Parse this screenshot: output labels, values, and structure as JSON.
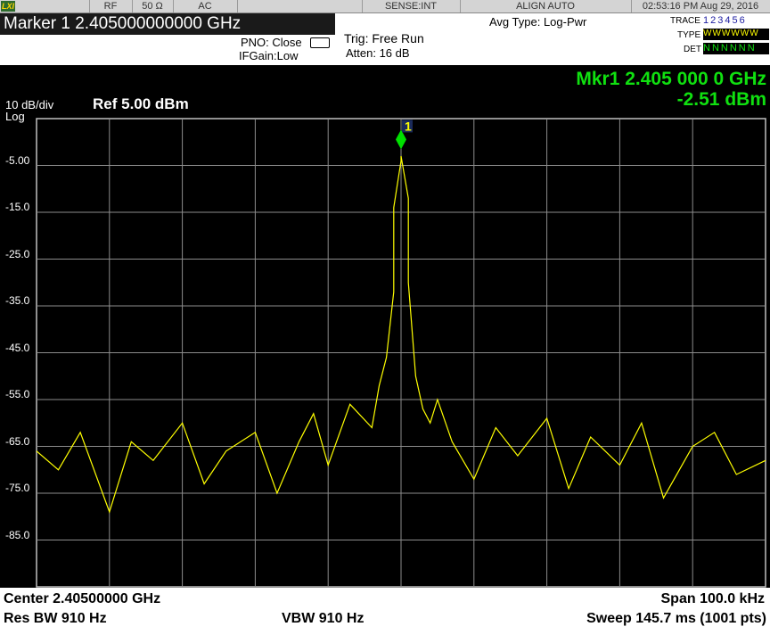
{
  "status_bar": {
    "lxi": "LXI",
    "rf": "RF",
    "impedance": "50 Ω",
    "coupling": "AC",
    "sense": "SENSE:INT",
    "align": "ALIGN AUTO",
    "datetime": "02:53:16 PM Aug 29, 2016"
  },
  "header": {
    "marker_title": "Marker 1  2.405000000000 GHz",
    "pno": "PNO: Close",
    "ifgain": "IFGain:Low",
    "trig": "Trig: Free Run",
    "atten": "Atten: 16 dB",
    "avg_type": "Avg Type: Log-Pwr",
    "trace_label": "TRACE",
    "trace_values": "123456",
    "type_label": "TYPE",
    "type_values": "WWWWWW",
    "det_label": "DET",
    "det_values": "NNNNNN"
  },
  "display": {
    "scale": "10 dB/div",
    "scale_type": "Log",
    "ref": "Ref  5.00 dBm",
    "marker_readout_freq": "Mkr1  2.405 000 0 GHz",
    "marker_readout_amp": "-2.51 dBm",
    "marker_label": "1",
    "y_ticks": [
      "-5.00",
      "-15.0",
      "-25.0",
      "-35.0",
      "-45.0",
      "-55.0",
      "-65.0",
      "-75.0",
      "-85.0"
    ]
  },
  "footer": {
    "center": "Center 2.40500000 GHz",
    "span": "Span 100.0 kHz",
    "res_bw": "Res BW 910 Hz",
    "vbw": "VBW 910 Hz",
    "sweep": "Sweep  145.7 ms (1001 pts)"
  },
  "colors": {
    "trace": "#ffff00",
    "grid": "#8c8c8c",
    "marker": "#00e000",
    "readout": "#10e010"
  },
  "chart_data": {
    "type": "line",
    "x_unit": "GHz",
    "y_unit": "dBm",
    "xlim": [
      2.40495,
      2.40505
    ],
    "ylim": [
      -95,
      5
    ],
    "grid": true,
    "series": [
      {
        "x": [
          2.40495,
          2.404953,
          2.404956,
          2.40496,
          2.404963,
          2.404966,
          2.40497,
          2.404973,
          2.404976,
          2.40498,
          2.404983,
          2.404986,
          2.404988,
          2.40499,
          2.404993,
          2.404996,
          2.404997,
          2.404998,
          2.404999,
          2.404999,
          2.405,
          2.405,
          2.405001,
          2.405001,
          2.405002,
          2.405003,
          2.405004,
          2.405005,
          2.405007,
          2.40501,
          2.405013,
          2.405016,
          2.40502,
          2.405023,
          2.405026,
          2.40503,
          2.405033,
          2.405036,
          2.40504,
          2.405043,
          2.405046,
          2.40505
        ],
        "y": [
          -66,
          -70,
          -62,
          -79,
          -64,
          -68,
          -60,
          -73,
          -66,
          -62,
          -75,
          -64,
          -58,
          -69,
          -56,
          -61,
          -52,
          -46,
          -32,
          -14,
          -4,
          -3,
          -12,
          -30,
          -50,
          -57,
          -60,
          -55,
          -64,
          -72,
          -61,
          -67,
          -59,
          -74,
          -63,
          -69,
          -60,
          -76,
          -65,
          -62,
          -71,
          -68
        ]
      }
    ],
    "marker": {
      "label": "1",
      "x": 2.405,
      "y": -2.51
    }
  }
}
